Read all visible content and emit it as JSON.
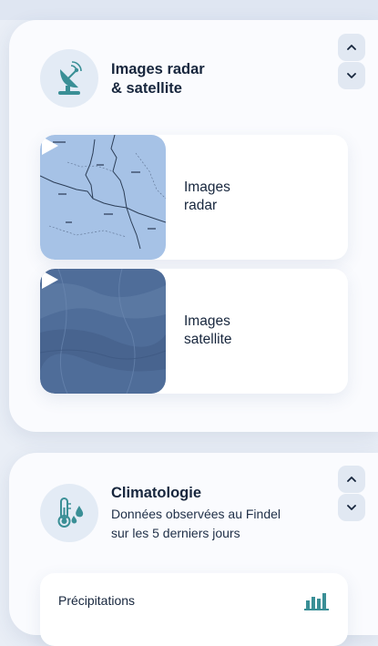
{
  "radar_section": {
    "title_line1": "Images radar",
    "title_line2": "& satellite",
    "icon": "satellite-dish-icon",
    "items": [
      {
        "label_line1": "Images",
        "label_line2": "radar",
        "thumbnail": "radar-map"
      },
      {
        "label_line1": "Images",
        "label_line2": "satellite",
        "thumbnail": "satellite-image"
      }
    ]
  },
  "climatology_section": {
    "title": "Climatologie",
    "subtitle_line1": "Données observées au Findel",
    "subtitle_line2": "sur les 5 derniers jours",
    "icon": "thermometer-raindrops-icon",
    "panel_label": "Précipitations",
    "panel_icon": "bar-chart-icon"
  },
  "controls": {
    "up_icon": "chevron-up-icon",
    "down_icon": "chevron-down-icon"
  },
  "colors": {
    "accent_teal": "#3a8f96",
    "text_dark": "#17263d",
    "background": "#e9eef6"
  }
}
